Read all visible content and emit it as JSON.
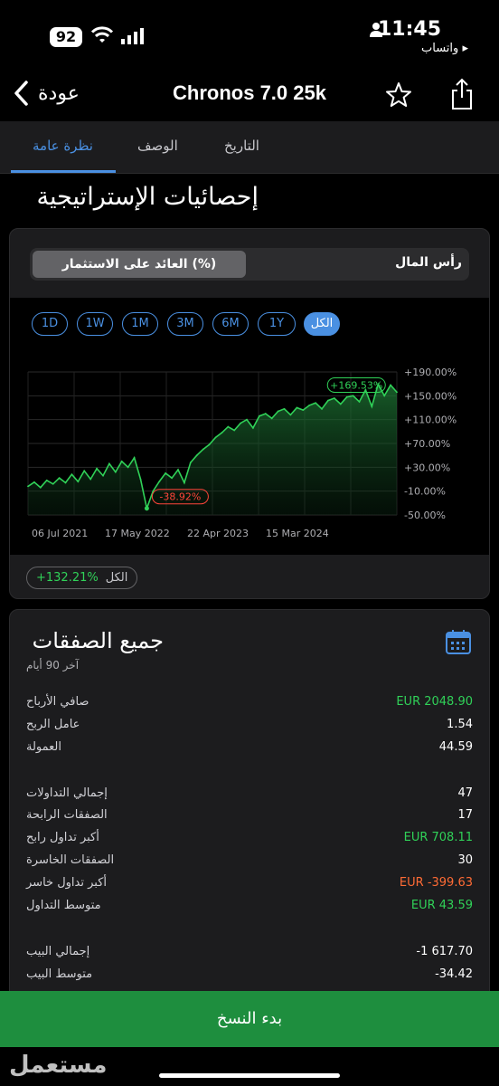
{
  "status": {
    "battery": "92",
    "time": "11:45",
    "back_app": "واتساب ▸"
  },
  "nav": {
    "back": "عودة",
    "title": "Chronos 7.0 25k"
  },
  "tabs": {
    "overview": "نظرة عامة",
    "description": "الوصف",
    "history": "التاريخ"
  },
  "section_title": "إحصائيات الإستراتيجية",
  "segment": {
    "roi": "العائد على الاستثمار (%)",
    "capital": "رأس المال"
  },
  "periods": [
    "1D",
    "1W",
    "1M",
    "3M",
    "6M",
    "1Y",
    "الكل"
  ],
  "chart_data": {
    "type": "area",
    "x_labels": [
      "06 Jul 2021",
      "17 May 2022",
      "22 Apr 2023",
      "15 Mar 2024"
    ],
    "y_ticks": [
      "+190.00%",
      "+150.00%",
      "+110.00%",
      "+70.00%",
      "+30.00%",
      "-10.00%",
      "-50.00%"
    ],
    "ylim": [
      -50,
      190
    ],
    "series": [
      {
        "values": [
          -2,
          5,
          -4,
          8,
          2,
          12,
          4,
          18,
          6,
          24,
          10,
          28,
          16,
          36,
          22,
          40,
          30,
          46,
          10,
          -38.92,
          -10,
          6,
          20,
          12,
          26,
          4,
          38,
          50,
          60,
          68,
          80,
          88,
          98,
          92,
          104,
          110,
          96,
          116,
          120,
          112,
          124,
          128,
          118,
          130,
          126,
          134,
          138,
          128,
          142,
          146,
          136,
          148,
          150,
          140,
          160,
          132,
          169.53,
          150,
          168,
          156
        ]
      }
    ],
    "annotations": {
      "max": "+169.53%",
      "min": "-38.92%"
    },
    "colors": {
      "line": "#30d158",
      "fill": "#0f3a1c",
      "max_label": "#30d158",
      "min_label": "#ff453a"
    }
  },
  "total": {
    "value": "+132.21%",
    "label": "الكل"
  },
  "trades": {
    "title": "جميع الصفقات",
    "subtitle": "آخر 90 أيام",
    "rows": [
      {
        "label": "صافي الأرباح",
        "value": "EUR 2048.90"
      },
      {
        "label": "عامل الربح",
        "value": "1.54"
      },
      {
        "label": "العمولة",
        "value": "44.59"
      },
      {
        "label": "إجمالي التداولات",
        "value": "47"
      },
      {
        "label": "الصفقات الرابحة",
        "value": "17"
      },
      {
        "label": "أكبر تداول رابح",
        "value": "EUR 708.11"
      },
      {
        "label": "الصفقات الخاسرة",
        "value": "30"
      },
      {
        "label": "أكبر تداول خاسر",
        "value": "EUR -399.63"
      },
      {
        "label": "متوسط التداول",
        "value": "EUR 43.59"
      },
      {
        "label": "إجمالي البيب",
        "value": "-1 617.70"
      },
      {
        "label": "متوسط البيب",
        "value": "-34.42"
      }
    ]
  },
  "copy_button": "بدء النسخ",
  "watermark": "مستعمل"
}
